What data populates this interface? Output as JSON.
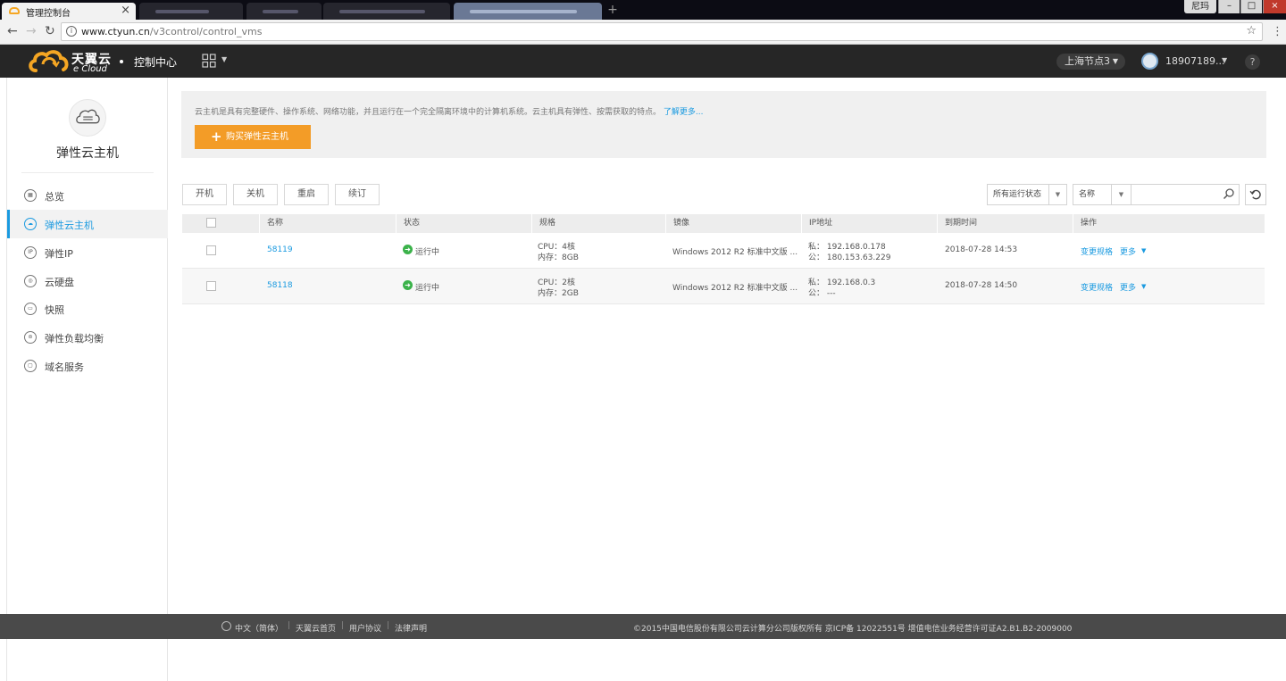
{
  "browser": {
    "active_tab_title": "管理控制台",
    "url_host": "www.ctyun.cn",
    "url_path": "/v3control/control_vms",
    "user_badge": "尼玛"
  },
  "header": {
    "logo_text": "天翼云",
    "logo_sub": "e Cloud",
    "title": "控制中心",
    "region": "上海节点3",
    "username": "18907189...",
    "help": "?"
  },
  "sidebar": {
    "title": "弹性云主机",
    "items": [
      {
        "label": "总览",
        "icon": "overview-icon"
      },
      {
        "label": "弹性云主机",
        "icon": "vm-icon"
      },
      {
        "label": "弹性IP",
        "icon": "ip-icon"
      },
      {
        "label": "云硬盘",
        "icon": "disk-icon"
      },
      {
        "label": "快照",
        "icon": "snapshot-icon"
      },
      {
        "label": "弹性负载均衡",
        "icon": "load-balancer-icon"
      },
      {
        "label": "域名服务",
        "icon": "dns-icon"
      }
    ]
  },
  "info": {
    "description": "云主机是具有完整硬件、操作系统、网络功能，并且运行在一个完全隔离环境中的计算机系统。云主机具有弹性、按需获取的特点。",
    "learn_more": "了解更多...",
    "buy_button": "购买弹性云主机"
  },
  "toolbar": {
    "start": "开机",
    "stop": "关机",
    "restart": "重启",
    "renew": "续订",
    "status_filter": "所有运行状态",
    "field_filter": "名称",
    "search_placeholder": ""
  },
  "table": {
    "headers": [
      "名称",
      "状态",
      "规格",
      "镜像",
      "IP地址",
      "到期时间",
      "操作"
    ],
    "rows": [
      {
        "name": "58119",
        "status": "运行中",
        "spec_cpu": "CPU：4核",
        "spec_mem": "内存：8GB",
        "image": "Windows 2012 R2 标准中文版 ...",
        "ip_private": "私： 192.168.0.178",
        "ip_public": "公： 180.153.63.229",
        "expire": "2018-07-28 14:53",
        "op_change": "变更规格",
        "op_more": "更多"
      },
      {
        "name": "58118",
        "status": "运行中",
        "spec_cpu": "CPU：2核",
        "spec_mem": "内存：2GB",
        "image": "Windows 2012 R2 标准中文版 ...",
        "ip_private": "私： 192.168.0.3",
        "ip_public": "公： ---",
        "expire": "2018-07-28 14:50",
        "op_change": "变更规格",
        "op_more": "更多"
      }
    ]
  },
  "footer": {
    "language": "中文（简体）",
    "home": "天翼云首页",
    "agreement": "用户协议",
    "legal": "法律声明",
    "copyright": "©2015中国电信股份有限公司云计算分公司版权所有 京ICP备 12022551号  增值电信业务经营许可证A2.B1.B2-2009000"
  },
  "colors": {
    "accent": "#1a9ae0",
    "buy_button": "#f39c27",
    "header_bg": "#262626",
    "running": "#3bb24a",
    "footer_bg": "#4a4a4a"
  }
}
